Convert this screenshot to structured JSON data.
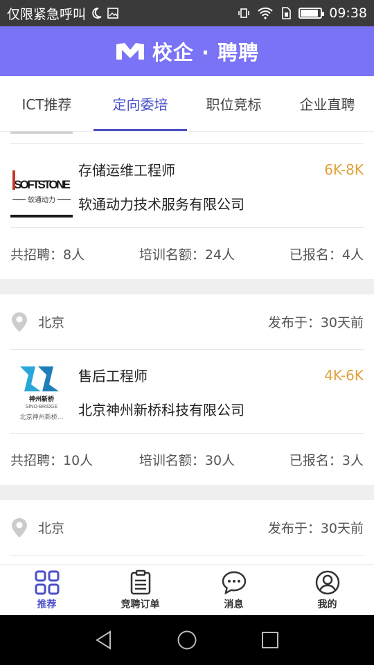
{
  "status_bar": {
    "left_text": "仅限紧急呼叫",
    "time": "09:38",
    "battery_level": 0.9
  },
  "app_bar": {
    "title": "校企 · 聘聘"
  },
  "tabs": [
    {
      "label": "ICT推荐",
      "active": false
    },
    {
      "label": "定向委培",
      "active": true
    },
    {
      "label": "职位竞标",
      "active": false
    },
    {
      "label": "企业直聘",
      "active": false
    }
  ],
  "jobs": [
    {
      "city": "",
      "published": "",
      "title": "存储运维工程师",
      "salary": "6K-8K",
      "company": "软通动力技术服务有限公司",
      "logo_text": "iSOFTSTONE",
      "logo_sub": "软通动力",
      "recruit": "共招聘：8人",
      "quota": "培训名额：24人",
      "enrolled": "已报名：4人"
    },
    {
      "city": "北京",
      "published": "发布于：30天前",
      "title": "售后工程师",
      "salary": "4K-6K",
      "company": "北京神州新桥科技有限公司",
      "logo_text": "神州新桥",
      "logo_sub": "SINO-BRIDGE",
      "logo_caption": "北京神州新桥...",
      "recruit": "共招聘：10人",
      "quota": "培训名额：30人",
      "enrolled": "已报名：3人"
    },
    {
      "city": "北京",
      "published": "发布于：30天前"
    }
  ],
  "bottom_nav": [
    {
      "label": "推荐",
      "icon": "grid-icon",
      "active": true
    },
    {
      "label": "竞聘订单",
      "icon": "clipboard-icon",
      "active": false
    },
    {
      "label": "消息",
      "icon": "chat-bubble-icon",
      "active": false
    },
    {
      "label": "我的",
      "icon": "user-icon",
      "active": false
    }
  ],
  "colors": {
    "brand": "#7a73f5",
    "accent": "#4a4fc8",
    "salary": "#e0a13a"
  }
}
